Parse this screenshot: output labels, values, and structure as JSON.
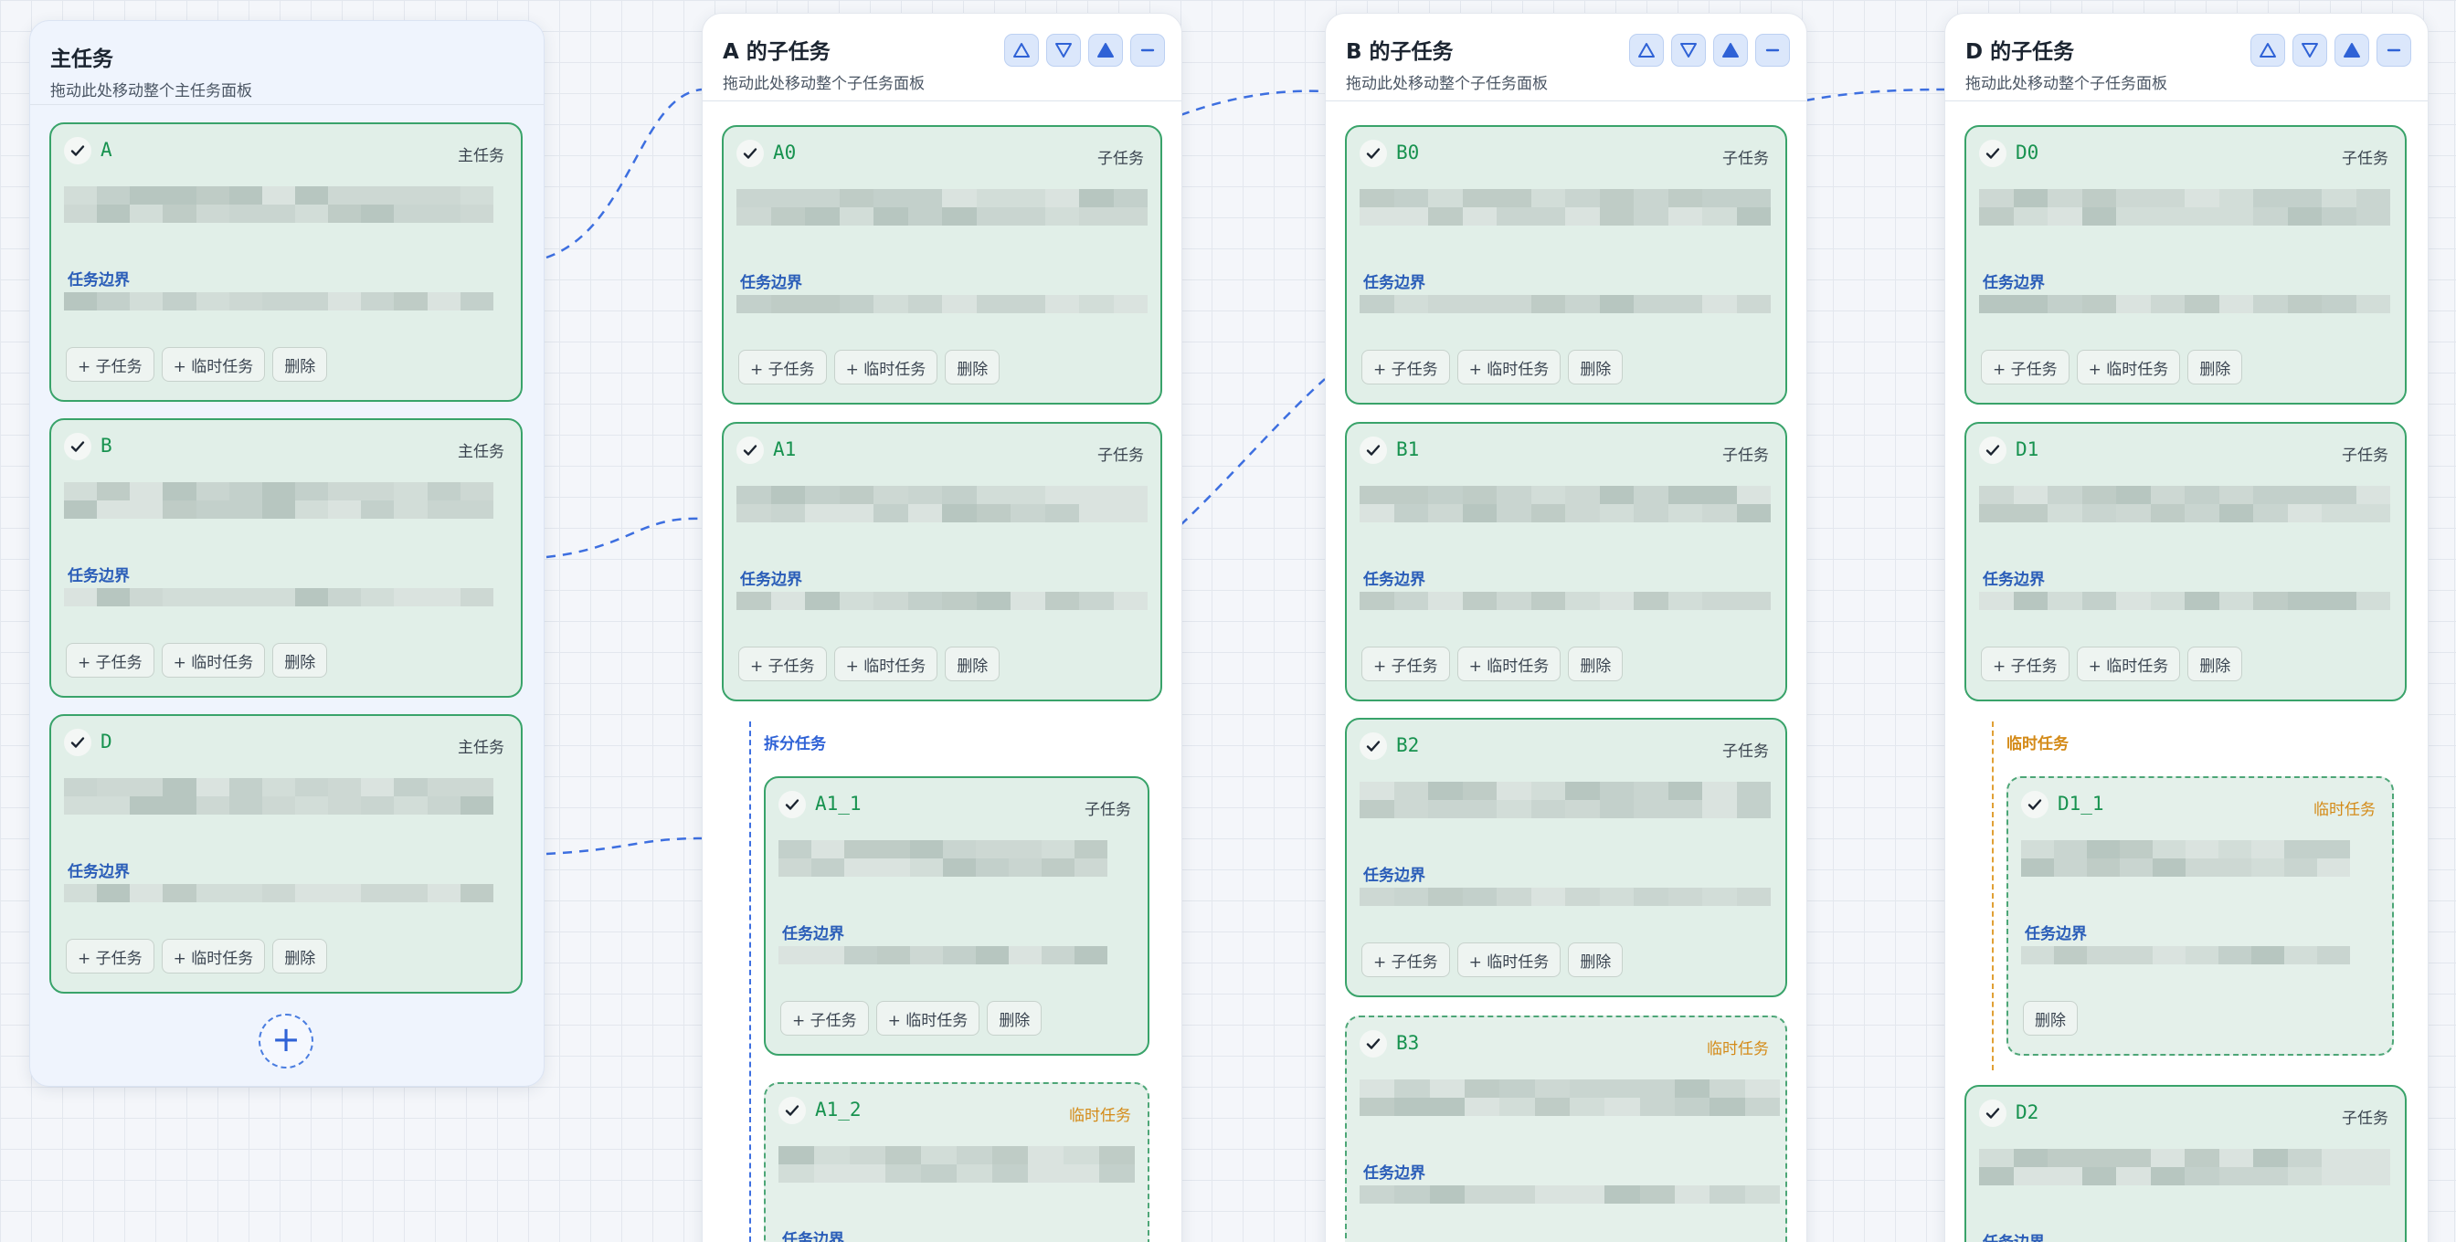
{
  "main_panel": {
    "title": "主任务",
    "subtitle": "拖动此处移动整个主任务面板",
    "add_icon": "plus-icon",
    "cards": [
      {
        "name": "A",
        "type": "主任务",
        "boundary": "任务边界",
        "actions": [
          "+ 子任务",
          "+ 临时任务",
          "删除"
        ]
      },
      {
        "name": "B",
        "type": "主任务",
        "boundary": "任务边界",
        "actions": [
          "+ 子任务",
          "+ 临时任务",
          "删除"
        ]
      },
      {
        "name": "D",
        "type": "主任务",
        "boundary": "任务边界",
        "actions": [
          "+ 子任务",
          "+ 临时任务",
          "删除"
        ]
      }
    ]
  },
  "panel_a": {
    "title": "A 的子任务",
    "subtitle": "拖动此处移动整个子任务面板",
    "controls": [
      "move-up-outline-icon",
      "move-down-outline-icon",
      "move-top-filled-icon",
      "collapse-minus-icon"
    ],
    "cards": [
      {
        "name": "A0",
        "type": "子任务",
        "boundary": "任务边界",
        "actions": [
          "+ 子任务",
          "+ 临时任务",
          "删除"
        ]
      },
      {
        "name": "A1",
        "type": "子任务",
        "boundary": "任务边界",
        "actions": [
          "+ 子任务",
          "+ 临时任务",
          "删除"
        ]
      }
    ],
    "group_label": "拆分任务",
    "group_cards": [
      {
        "name": "A1_1",
        "type": "子任务",
        "boundary": "任务边界",
        "actions": [
          "+ 子任务",
          "+ 临时任务",
          "删除"
        ]
      },
      {
        "name": "A1_2",
        "type": "临时任务",
        "boundary": "任务边界"
      }
    ]
  },
  "panel_b": {
    "title": "B 的子任务",
    "subtitle": "拖动此处移动整个子任务面板",
    "controls": [
      "move-up-outline-icon",
      "move-down-outline-icon",
      "move-top-filled-icon",
      "collapse-minus-icon"
    ],
    "cards": [
      {
        "name": "B0",
        "type": "子任务",
        "boundary": "任务边界",
        "actions": [
          "+ 子任务",
          "+ 临时任务",
          "删除"
        ]
      },
      {
        "name": "B1",
        "type": "子任务",
        "boundary": "任务边界",
        "actions": [
          "+ 子任务",
          "+ 临时任务",
          "删除"
        ]
      },
      {
        "name": "B2",
        "type": "子任务",
        "boundary": "任务边界",
        "actions": [
          "+ 子任务",
          "+ 临时任务",
          "删除"
        ]
      },
      {
        "name": "B3",
        "type": "临时任务",
        "boundary": "任务边界"
      }
    ]
  },
  "panel_d": {
    "title": "D 的子任务",
    "subtitle": "拖动此处移动整个子任务面板",
    "controls": [
      "move-up-outline-icon",
      "move-down-outline-icon",
      "move-top-filled-icon",
      "collapse-minus-icon"
    ],
    "cards": [
      {
        "name": "D0",
        "type": "子任务",
        "boundary": "任务边界",
        "actions": [
          "+ 子任务",
          "+ 临时任务",
          "删除"
        ]
      },
      {
        "name": "D1",
        "type": "子任务",
        "boundary": "任务边界",
        "actions": [
          "+ 子任务",
          "+ 临时任务",
          "删除"
        ]
      }
    ],
    "group_label": "临时任务",
    "group_cards": [
      {
        "name": "D1_1",
        "type": "临时任务",
        "boundary": "任务边界",
        "actions": [
          "删除"
        ]
      }
    ],
    "tail_cards": [
      {
        "name": "D2",
        "type": "子任务",
        "boundary": "任务边界"
      }
    ]
  },
  "colors": {
    "card_border": "#39a36a",
    "card_fill": "#e1efe8",
    "task_name": "#17924f",
    "boundary_label": "#2a5db8",
    "temp_label": "#d48a17",
    "connector": "#3d6fe0",
    "control_button": "#dbe7fb"
  }
}
